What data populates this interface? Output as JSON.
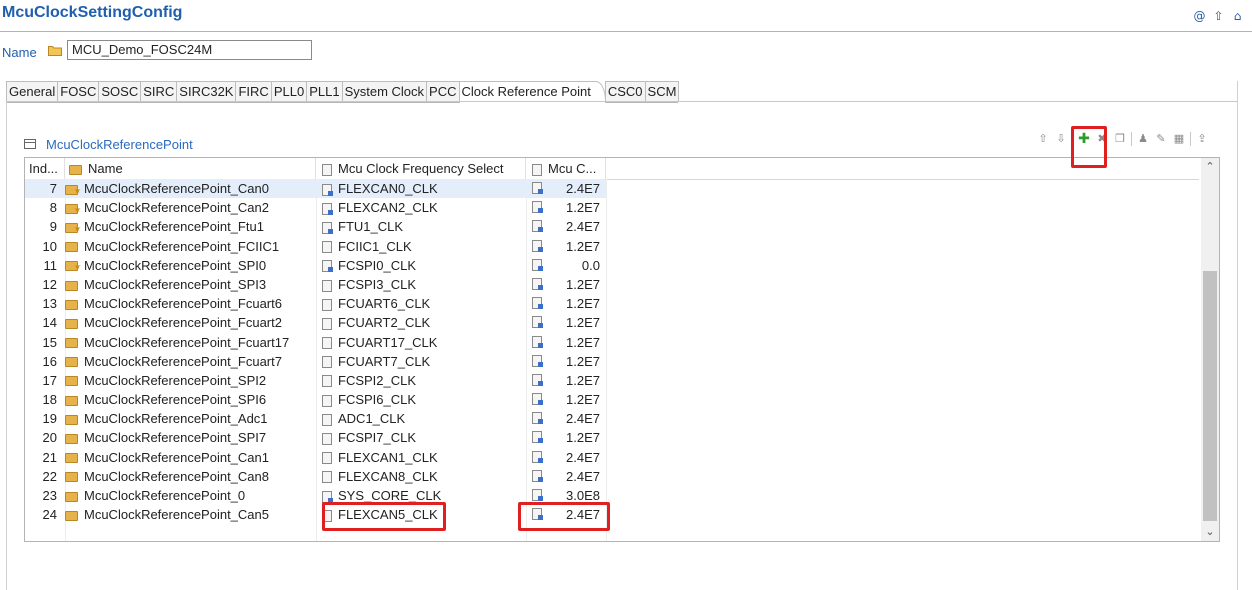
{
  "header": {
    "title": "McuClockSettingConfig",
    "icons": [
      "at-icon",
      "up-arrow-icon",
      "home-icon"
    ]
  },
  "name_field": {
    "label": "Name",
    "value": "MCU_Demo_FOSC24M"
  },
  "tabs": [
    {
      "label": "General"
    },
    {
      "label": "FOSC"
    },
    {
      "label": "SOSC"
    },
    {
      "label": "SIRC"
    },
    {
      "label": "SIRC32K"
    },
    {
      "label": "FIRC"
    },
    {
      "label": "PLL0"
    },
    {
      "label": "PLL1"
    },
    {
      "label": "System Clock"
    },
    {
      "label": "PCC"
    },
    {
      "label": "Clock Reference Point",
      "active": true
    },
    {
      "label": "CSC0"
    },
    {
      "label": "SCM"
    }
  ],
  "section": {
    "title": "McuClockReferencePoint"
  },
  "table": {
    "headers": {
      "index": "Ind...",
      "name": "Name",
      "freq_select": "Mcu Clock Frequency Select",
      "freq": "Mcu C..."
    },
    "rows": [
      {
        "index": "7",
        "name": "McuClockReferencePoint_Can0",
        "freq_select": "FLEXCAN0_CLK",
        "freq": "2.4E7",
        "star": true,
        "blue": true,
        "selected": true
      },
      {
        "index": "8",
        "name": "McuClockReferencePoint_Can2",
        "freq_select": "FLEXCAN2_CLK",
        "freq": "1.2E7",
        "star": true,
        "blue": true
      },
      {
        "index": "9",
        "name": "McuClockReferencePoint_Ftu1",
        "freq_select": "FTU1_CLK",
        "freq": "2.4E7",
        "star": true,
        "blue": true
      },
      {
        "index": "10",
        "name": "McuClockReferencePoint_FCIIC1",
        "freq_select": "FCIIC1_CLK",
        "freq": "1.2E7",
        "star": false,
        "blue": false
      },
      {
        "index": "11",
        "name": "McuClockReferencePoint_SPI0",
        "freq_select": "FCSPI0_CLK",
        "freq": "0.0",
        "star": true,
        "blue": true
      },
      {
        "index": "12",
        "name": "McuClockReferencePoint_SPI3",
        "freq_select": "FCSPI3_CLK",
        "freq": "1.2E7",
        "star": false,
        "blue": false
      },
      {
        "index": "13",
        "name": "McuClockReferencePoint_Fcuart6",
        "freq_select": "FCUART6_CLK",
        "freq": "1.2E7",
        "star": false,
        "blue": false
      },
      {
        "index": "14",
        "name": "McuClockReferencePoint_Fcuart2",
        "freq_select": "FCUART2_CLK",
        "freq": "1.2E7",
        "star": false,
        "blue": false
      },
      {
        "index": "15",
        "name": "McuClockReferencePoint_Fcuart17",
        "freq_select": "FCUART17_CLK",
        "freq": "1.2E7",
        "star": false,
        "blue": false
      },
      {
        "index": "16",
        "name": "McuClockReferencePoint_Fcuart7",
        "freq_select": "FCUART7_CLK",
        "freq": "1.2E7",
        "star": false,
        "blue": false
      },
      {
        "index": "17",
        "name": "McuClockReferencePoint_SPI2",
        "freq_select": "FCSPI2_CLK",
        "freq": "1.2E7",
        "star": false,
        "blue": false
      },
      {
        "index": "18",
        "name": "McuClockReferencePoint_SPI6",
        "freq_select": "FCSPI6_CLK",
        "freq": "1.2E7",
        "star": false,
        "blue": false
      },
      {
        "index": "19",
        "name": "McuClockReferencePoint_Adc1",
        "freq_select": "ADC1_CLK",
        "freq": "2.4E7",
        "star": false,
        "blue": false
      },
      {
        "index": "20",
        "name": "McuClockReferencePoint_SPI7",
        "freq_select": "FCSPI7_CLK",
        "freq": "1.2E7",
        "star": false,
        "blue": false
      },
      {
        "index": "21",
        "name": "McuClockReferencePoint_Can1",
        "freq_select": "FLEXCAN1_CLK",
        "freq": "2.4E7",
        "star": false,
        "blue": false
      },
      {
        "index": "22",
        "name": "McuClockReferencePoint_Can8",
        "freq_select": "FLEXCAN8_CLK",
        "freq": "2.4E7",
        "star": false,
        "blue": false
      },
      {
        "index": "23",
        "name": "McuClockReferencePoint_0",
        "freq_select": "SYS_CORE_CLK",
        "freq": "3.0E8",
        "star": false,
        "blue": true
      },
      {
        "index": "24",
        "name": "McuClockReferencePoint_Can5",
        "freq_select": "FLEXCAN5_CLK",
        "freq": "2.4E7",
        "star": false,
        "blue": false
      }
    ]
  },
  "colors": {
    "title": "#1f5fae",
    "highlight": "#e02020",
    "add": "#2e9b2e"
  }
}
